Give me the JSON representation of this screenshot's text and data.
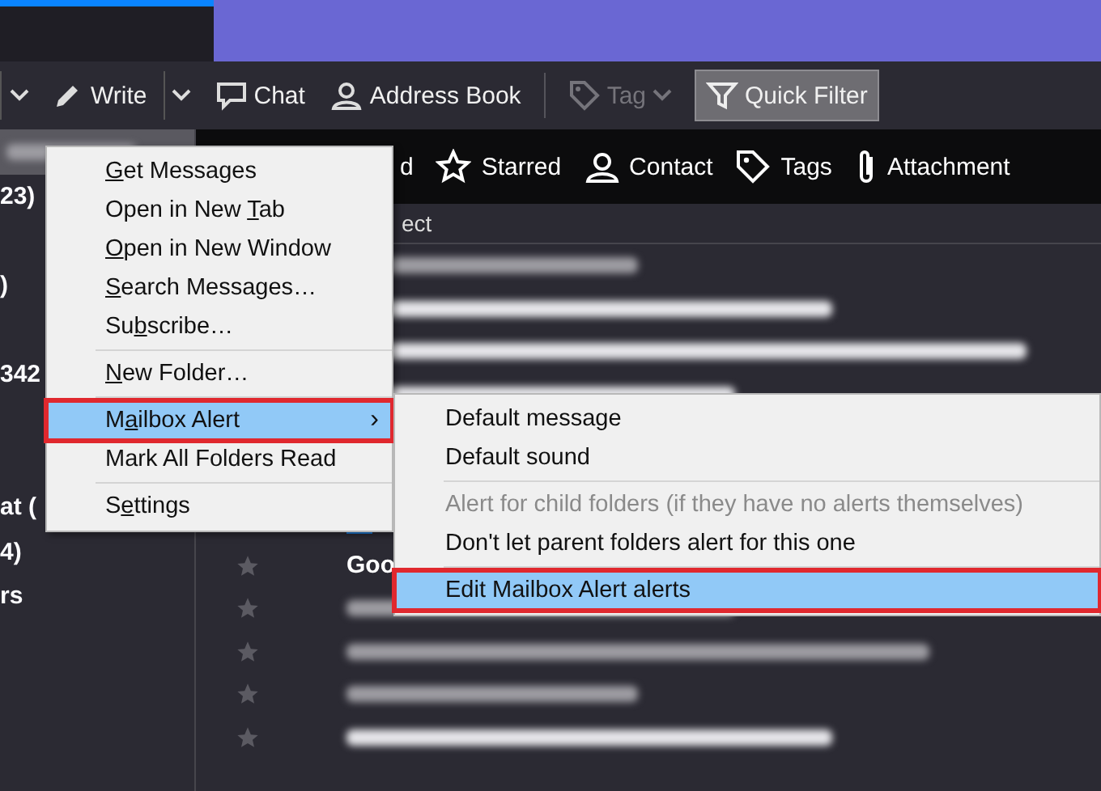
{
  "toolbar": {
    "items": [
      {
        "kind": "split_caret"
      },
      {
        "kind": "write",
        "label": "Write",
        "disabled": false,
        "pressed": false
      },
      {
        "kind": "split_caret"
      },
      {
        "kind": "chat",
        "label": "Chat",
        "disabled": false,
        "pressed": false
      },
      {
        "kind": "address_book",
        "label": "Address Book",
        "disabled": false,
        "pressed": false
      },
      {
        "kind": "separator"
      },
      {
        "kind": "tag",
        "label": "Tag",
        "disabled": true,
        "pressed": false
      },
      {
        "kind": "quick_filter",
        "label": "Quick Filter",
        "disabled": false,
        "pressed": true
      }
    ]
  },
  "folder_pane": {
    "items": [
      {
        "kind": "blurred",
        "selected": true
      },
      {
        "kind": "folder",
        "label": "23)",
        "selected": false
      },
      {
        "kind": "covered"
      },
      {
        "kind": "folder",
        "label": ")",
        "selected": false
      },
      {
        "kind": "covered"
      },
      {
        "kind": "folder",
        "label": "342",
        "selected": false
      },
      {
        "kind": "covered"
      },
      {
        "kind": "covered"
      },
      {
        "kind": "folder",
        "label": "at (",
        "selected": false
      },
      {
        "kind": "folder",
        "label": "4)",
        "selected": false
      },
      {
        "kind": "folder",
        "label": "rs",
        "selected": false
      }
    ]
  },
  "quick_filter_bar": {
    "items": [
      {
        "kind": "unread",
        "label": "d"
      },
      {
        "kind": "starred",
        "label": "Starred"
      },
      {
        "kind": "contact",
        "label": "Contact"
      },
      {
        "kind": "tags",
        "label": "Tags"
      },
      {
        "kind": "attachment",
        "label": "Attachment"
      }
    ]
  },
  "message_list": {
    "column_header": "ect",
    "rows": [
      {
        "kind": "blurred",
        "bold": false
      },
      {
        "kind": "blurred",
        "bold": true
      },
      {
        "kind": "blurred",
        "bold": true
      },
      {
        "kind": "blurred",
        "bold": true
      },
      {
        "kind": "covered"
      },
      {
        "kind": "covered"
      },
      {
        "kind": "icon"
      },
      {
        "kind": "text",
        "bold": true,
        "subject": "Goo",
        "star": true
      },
      {
        "kind": "blurred",
        "bold": false,
        "star": true
      },
      {
        "kind": "blurred",
        "bold": false,
        "star": true
      },
      {
        "kind": "blurred",
        "bold": false,
        "star": true
      },
      {
        "kind": "blurred",
        "bold": true,
        "star": true
      }
    ]
  },
  "context_menu": {
    "items": [
      {
        "kind": "item",
        "access_key": "G",
        "after": "et Messages",
        "highlighted": false,
        "outlined": false
      },
      {
        "kind": "item",
        "before": "Open in New ",
        "access_key": "T",
        "after": "ab",
        "highlighted": false,
        "outlined": false
      },
      {
        "kind": "item",
        "access_key": "O",
        "after": "pen in New Window",
        "highlighted": false,
        "outlined": false
      },
      {
        "kind": "item",
        "access_key": "S",
        "after": "earch Messages…",
        "highlighted": false,
        "outlined": false
      },
      {
        "kind": "item",
        "before": "Su",
        "access_key": "b",
        "after": "scribe…",
        "highlighted": false,
        "outlined": false
      },
      {
        "kind": "separator"
      },
      {
        "kind": "item",
        "access_key": "N",
        "after": "ew Folder…",
        "highlighted": false,
        "outlined": false
      },
      {
        "kind": "separator"
      },
      {
        "kind": "item",
        "before": "M",
        "access_key": "a",
        "after": "ilbox Alert",
        "submenu_arrow": "›",
        "highlighted": true,
        "outlined": true
      },
      {
        "kind": "item",
        "before": "Mark All Folders Read",
        "highlighted": false,
        "outlined": false
      },
      {
        "kind": "separator"
      },
      {
        "kind": "item",
        "before": "S",
        "access_key": "e",
        "after": "ttings",
        "highlighted": false,
        "outlined": false
      }
    ]
  },
  "submenu": {
    "items": [
      {
        "kind": "item",
        "label": "Default message",
        "disabled": false,
        "highlighted": false,
        "outlined": false
      },
      {
        "kind": "item",
        "label": "Default sound",
        "disabled": false,
        "highlighted": false,
        "outlined": false
      },
      {
        "kind": "separator"
      },
      {
        "kind": "item",
        "label": "Alert for child folders (if they have no alerts themselves)",
        "disabled": true,
        "highlighted": false,
        "outlined": false
      },
      {
        "kind": "item",
        "label": "Don't let parent folders alert for this one",
        "disabled": false,
        "highlighted": false,
        "outlined": false
      },
      {
        "kind": "separator"
      },
      {
        "kind": "item",
        "label": "Edit Mailbox Alert alerts",
        "disabled": false,
        "highlighted": true,
        "outlined": true
      }
    ]
  }
}
